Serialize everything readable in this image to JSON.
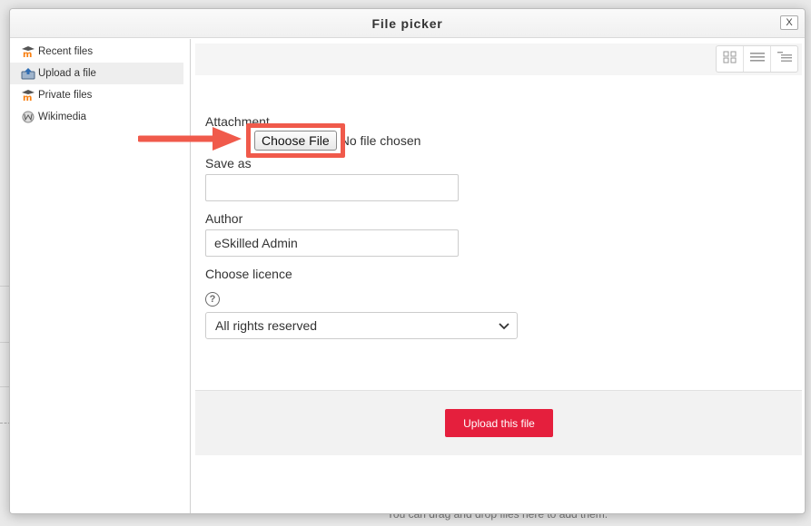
{
  "dialog": {
    "title": "File picker",
    "close_label": "X"
  },
  "sidebar": {
    "items": [
      {
        "label": "Recent files",
        "icon": "moodle-icon"
      },
      {
        "label": "Upload a file",
        "icon": "upload-icon"
      },
      {
        "label": "Private files",
        "icon": "moodle-icon"
      },
      {
        "label": "Wikimedia",
        "icon": "wikimedia-icon"
      }
    ],
    "active_index": 1
  },
  "toolbar": {
    "views": [
      "icons-view-icon",
      "list-view-icon",
      "tree-view-icon"
    ]
  },
  "form": {
    "attachment_label": "Attachment",
    "choose_file_label": "Choose File",
    "no_file_text": "No file chosen",
    "save_as_label": "Save as",
    "save_as_value": "",
    "author_label": "Author",
    "author_value": "eSkilled Admin",
    "licence_label": "Choose licence",
    "licence_value": "All rights reserved",
    "upload_button_label": "Upload this file"
  },
  "background": {
    "drop_text": "You can drag and drop files here to add them."
  },
  "colors": {
    "primary_button": "#e51f3d",
    "highlight": "#f05a4b"
  }
}
